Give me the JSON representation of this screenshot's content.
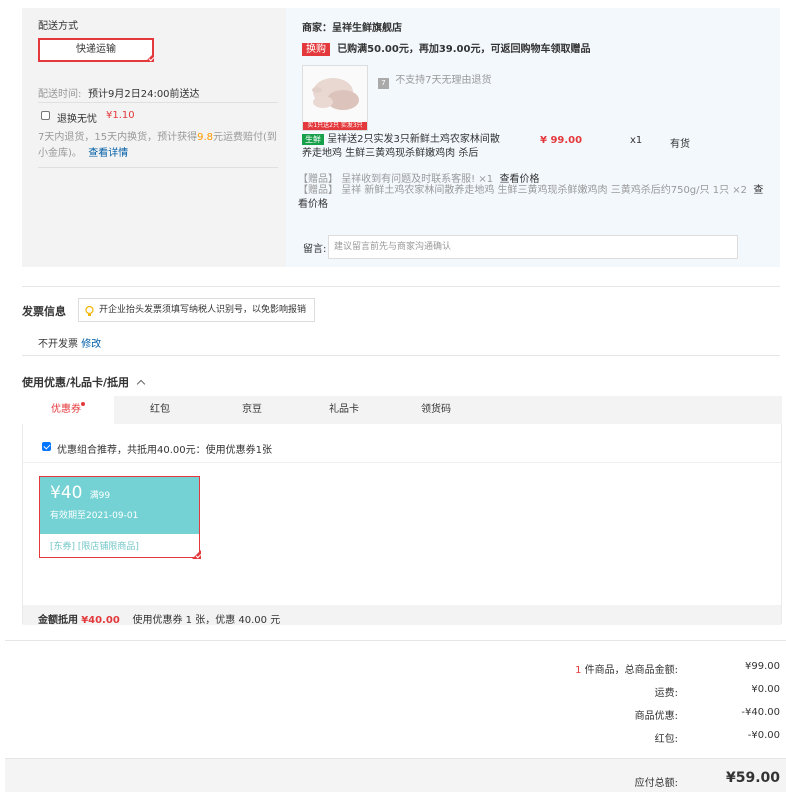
{
  "shipping": {
    "title": "配送方式",
    "method": "快递运输",
    "time_label": "配送时间:",
    "time_value": "预计9月2日24:00前送达",
    "insurance_label": "退换无忧",
    "insurance_price": "¥1.10",
    "insurance_desc_1": "7天内退货，15天内换货，预计获得",
    "insurance_desc_amount": "9.8",
    "insurance_desc_2": "元运费赔付(到小金库)。",
    "insurance_link": "查看详情"
  },
  "store": {
    "label": "商家：呈祥生鲜旗舰店",
    "promo_tag": "换购",
    "promo_text": "已购满50.00元，再加39.00元，可返回购物车领取赠品",
    "no_return_text": "不支持7天无理由退货",
    "img_banner": "买1只送2只 实发3只",
    "item_tag": "生鲜",
    "item_name": "呈祥送2只实发3只新鲜土鸡农家林间散养走地鸡 生鲜三黄鸡现杀鲜嫩鸡肉 杀后",
    "item_price": "¥ 99.00",
    "item_qty": "x1",
    "item_stock": "有货",
    "gift1_prefix": "【赠品】",
    "gift1_text": "呈祥收到有问题及时联系客服! ×1",
    "gift1_link": "查看价格",
    "gift2_prefix": "【赠品】",
    "gift2_text": "呈祥 新鲜土鸡农家林间散养走地鸡 生鲜三黄鸡现杀鲜嫩鸡肉 三黄鸡杀后约750g/只 1只 ×2",
    "gift2_link": "查看价格",
    "note_label": "留言:",
    "note_placeholder": "建议留言前先与商家沟通确认"
  },
  "invoice": {
    "title": "发票信息",
    "tip": "开企业抬头发票须填写纳税人识别号，以免影响报销",
    "value": "不开发票",
    "edit": "修改"
  },
  "discount": {
    "title": "使用优惠/礼品卡/抵用",
    "tabs": [
      {
        "label": "优惠券"
      },
      {
        "label": "红包"
      },
      {
        "label": "京豆"
      },
      {
        "label": "礼品卡"
      },
      {
        "label": "领货码"
      }
    ],
    "combo_text": "优惠组合推荐，共抵用40.00元：使用优惠券1张",
    "coupon_amount": "¥40",
    "coupon_condition": "满99",
    "coupon_expiry": "有效期至2021-09-01",
    "coupon_tags": "[东券] [限店铺限商品]",
    "footer_label": "金额抵用",
    "footer_amount": "¥40.00",
    "footer_desc": "使用优惠券 1 张，优惠 40.00 元"
  },
  "summary": {
    "count": "1",
    "count_label": "件商品，总商品金额:",
    "goods_amount": "¥99.00",
    "freight_label": "运费:",
    "freight": "¥0.00",
    "discount_label": "商品优惠:",
    "discount": "-¥40.00",
    "redpacket_label": "红包:",
    "redpacket": "-¥0.00",
    "total_label": "应付总额:",
    "total": "¥59.00"
  },
  "colors": {
    "accent": "#e4393c",
    "link": "#005ea7",
    "coupon": "#74d2d4"
  }
}
